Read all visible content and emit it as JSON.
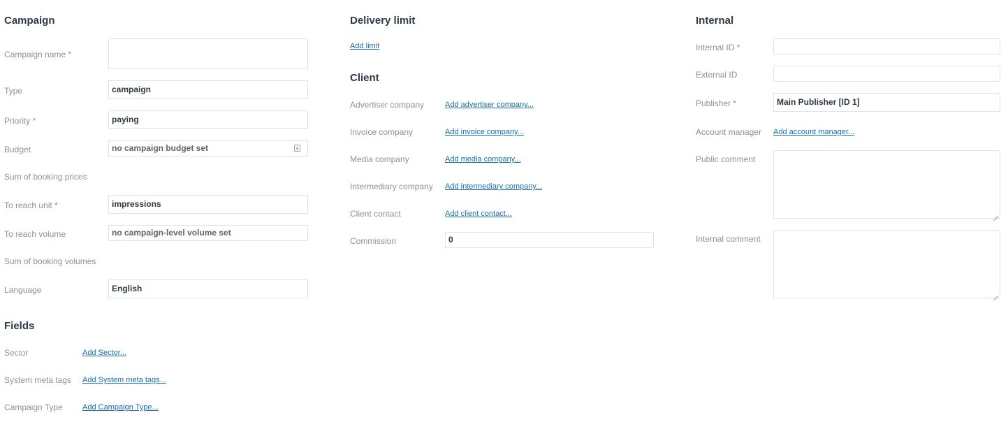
{
  "campaign": {
    "title": "Campaign",
    "name_label": "Campaign name *",
    "name_value": "",
    "type_label": "Type",
    "type_value": "campaign",
    "priority_label": "Priority *",
    "priority_value": "paying",
    "budget_label": "Budget",
    "budget_value": "no campaign budget set",
    "sum_booking_prices_label": "Sum of booking prices",
    "reach_unit_label": "To reach unit *",
    "reach_unit_value": "impressions",
    "reach_volume_label": "To reach volume",
    "reach_volume_value": "no campaign-level volume set",
    "sum_booking_volumes_label": "Sum of booking volumes",
    "language_label": "Language",
    "language_value": "English"
  },
  "fields": {
    "title": "Fields",
    "sector_label": "Sector",
    "sector_link": "Add Sector...",
    "meta_tags_label": "System meta tags",
    "meta_tags_link": "Add System meta tags...",
    "campaign_type_label": "Campaign Type",
    "campaign_type_link": "Add Campaign Type..."
  },
  "delivery": {
    "title": "Delivery limit",
    "add_limit_link": "Add limit"
  },
  "client": {
    "title": "Client",
    "advertiser_label": "Advertiser company",
    "advertiser_link": "Add advertiser company...",
    "invoice_label": "Invoice company",
    "invoice_link": "Add invoice company...",
    "media_label": "Media company",
    "media_link": "Add media company...",
    "intermediary_label": "Intermediary company",
    "intermediary_link": "Add intermediary company...",
    "contact_label": "Client contact",
    "contact_link": "Add client contact...",
    "commission_label": "Commission",
    "commission_value": "0"
  },
  "internal": {
    "title": "Internal",
    "internal_id_label": "Internal ID *",
    "internal_id_value": "",
    "external_id_label": "External ID",
    "external_id_value": "",
    "publisher_label": "Publisher *",
    "publisher_value": "Main Publisher [ID 1]",
    "account_manager_label": "Account manager",
    "account_manager_link": "Add account manager...",
    "public_comment_label": "Public comment",
    "public_comment_value": "",
    "internal_comment_label": "Internal comment",
    "internal_comment_value": ""
  },
  "colors": {
    "link": "#1a6fb0",
    "label": "#8a9298",
    "heading": "#2f3a44",
    "border": "#dfe3e6"
  },
  "icons": {
    "budget_field": "calendar-icon",
    "textarea": "resize-grip-icon"
  }
}
